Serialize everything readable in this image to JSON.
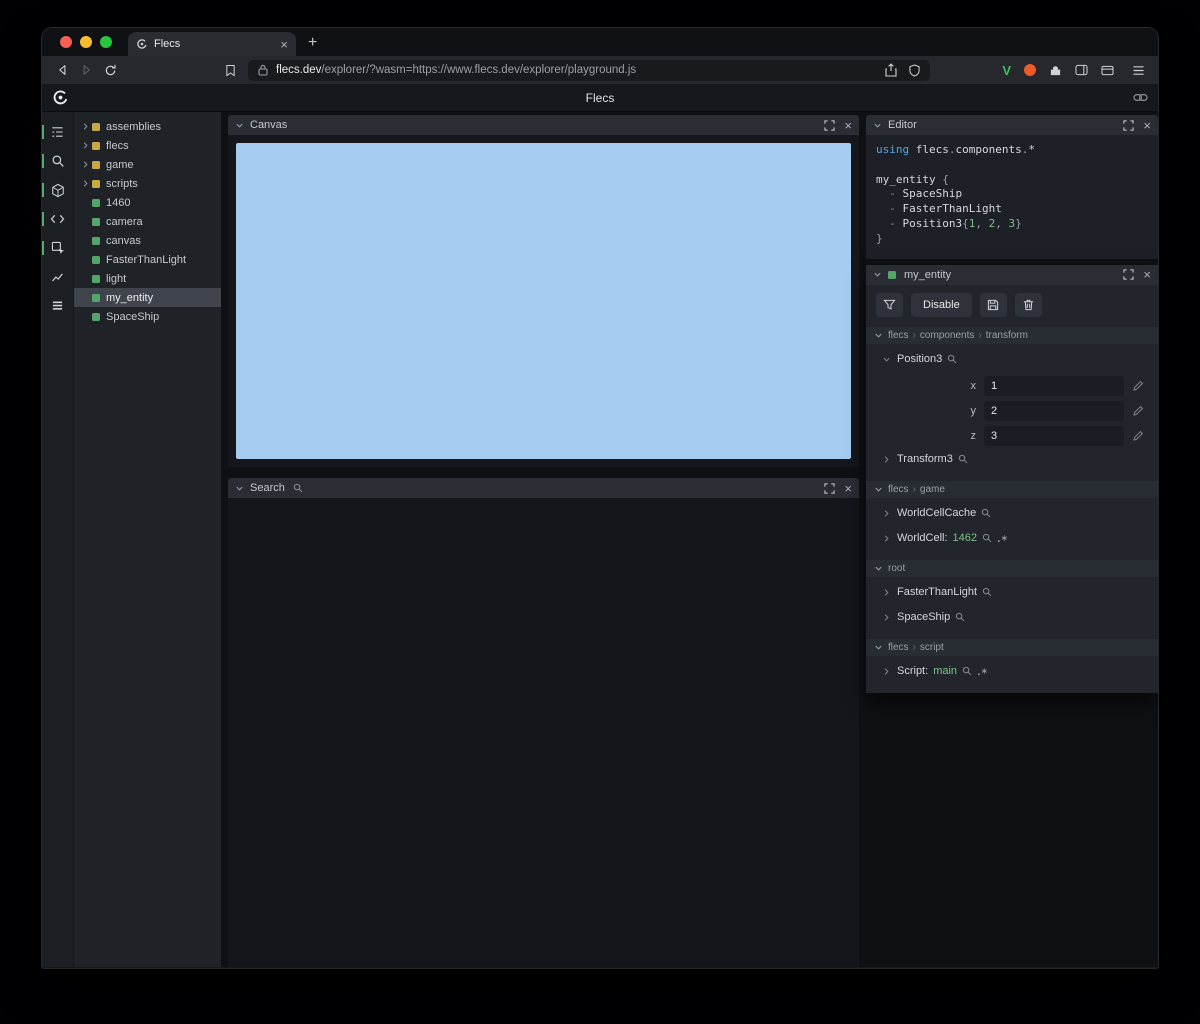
{
  "colors": {
    "canvas_blue": "#a6cdf1",
    "entity_green": "#55a46a",
    "module_yellow": "#c9a944",
    "value_green": "#7cc388",
    "keyword_blue": "#58a7e0",
    "active_indicator_green": "#57aa6b",
    "v_icon_green": "#3fbf5f",
    "orange_icon": "#ef5a28",
    "traffic_red": "#f95f57",
    "traffic_yellow": "#fbbd2e",
    "traffic_green": "#29c73f"
  },
  "glyphs": {
    "close": "×",
    "plus": "+"
  },
  "browser": {
    "tab_title": "Flecs",
    "url_domain": "flecs.dev",
    "url_path": "/explorer/?wasm=https://www.flecs.dev/explorer/playground.js",
    "extensions": [
      {
        "name": "v-extension-icon",
        "letter": "V"
      }
    ]
  },
  "app": {
    "title": "Flecs"
  },
  "sidebar": {
    "icons": [
      {
        "name": "tree-panel-button",
        "glyph": "tree",
        "active": true
      },
      {
        "name": "search-panel-button",
        "glyph": "search",
        "active": true
      },
      {
        "name": "entities-panel-button",
        "glyph": "cube",
        "active": true
      },
      {
        "name": "editor-panel-button",
        "glyph": "code",
        "active": true
      },
      {
        "name": "inspector-panel-button",
        "glyph": "inspect",
        "active": true
      },
      {
        "name": "charts-panel-button",
        "glyph": "chart",
        "active": false
      },
      {
        "name": "stats-panel-button",
        "glyph": "stats",
        "active": false
      }
    ]
  },
  "tree": {
    "items": [
      {
        "label": "assemblies",
        "kind": "module",
        "expandable": true
      },
      {
        "label": "flecs",
        "kind": "module",
        "expandable": true
      },
      {
        "label": "game",
        "kind": "module",
        "expandable": true
      },
      {
        "label": "scripts",
        "kind": "module",
        "expandable": true
      },
      {
        "label": "1460",
        "kind": "entity"
      },
      {
        "label": "camera",
        "kind": "entity"
      },
      {
        "label": "canvas",
        "kind": "entity"
      },
      {
        "label": "FasterThanLight",
        "kind": "entity"
      },
      {
        "label": "light",
        "kind": "entity"
      },
      {
        "label": "my_entity",
        "kind": "entity",
        "selected": true
      },
      {
        "label": "SpaceShip",
        "kind": "entity"
      }
    ]
  },
  "canvas_panel": {
    "title": "Canvas"
  },
  "search_panel": {
    "title": "Search"
  },
  "editor": {
    "title": "Editor",
    "lines": [
      [
        {
          "t": "using ",
          "c": "kw"
        },
        {
          "t": "flecs",
          "c": "id"
        },
        {
          "t": ".",
          "c": "p"
        },
        {
          "t": "components",
          "c": "id"
        },
        {
          "t": ".",
          "c": "p"
        },
        {
          "t": "*",
          "c": "id"
        }
      ],
      [],
      [
        {
          "t": "my_entity ",
          "c": "id"
        },
        {
          "t": "{",
          "c": "p"
        }
      ],
      [
        {
          "t": "  - ",
          "c": "dash"
        },
        {
          "t": "SpaceShip",
          "c": "id"
        }
      ],
      [
        {
          "t": "  - ",
          "c": "dash"
        },
        {
          "t": "FasterThanLight",
          "c": "id"
        }
      ],
      [
        {
          "t": "  - ",
          "c": "dash"
        },
        {
          "t": "Position3",
          "c": "id"
        },
        {
          "t": "{",
          "c": "p"
        },
        {
          "t": "1",
          "c": "num"
        },
        {
          "t": ", ",
          "c": "p"
        },
        {
          "t": "2",
          "c": "num"
        },
        {
          "t": ", ",
          "c": "p"
        },
        {
          "t": "3",
          "c": "num"
        },
        {
          "t": "}",
          "c": "p"
        }
      ],
      [
        {
          "t": "}",
          "c": "p"
        }
      ]
    ]
  },
  "inspector": {
    "title": "my_entity",
    "disable_label": "Disable",
    "sections": [
      {
        "path": [
          "flecs",
          "components",
          "transform"
        ],
        "items": [
          {
            "label": "Position3",
            "expanded": true,
            "fields": [
              {
                "name": "x",
                "value": "1"
              },
              {
                "name": "y",
                "value": "2"
              },
              {
                "name": "z",
                "value": "3"
              }
            ]
          },
          {
            "label": "Transform3"
          }
        ]
      },
      {
        "path": [
          "flecs",
          "game"
        ],
        "items": [
          {
            "label": "WorldCellCache"
          },
          {
            "label": "WorldCell:",
            "value": "1462",
            "pair": true
          }
        ]
      },
      {
        "path": [
          "root"
        ],
        "items": [
          {
            "label": "FasterThanLight"
          },
          {
            "label": "SpaceShip"
          }
        ]
      },
      {
        "path": [
          "flecs",
          "script"
        ],
        "items": [
          {
            "label": "Script:",
            "value": "main",
            "pair": true
          }
        ]
      }
    ]
  }
}
